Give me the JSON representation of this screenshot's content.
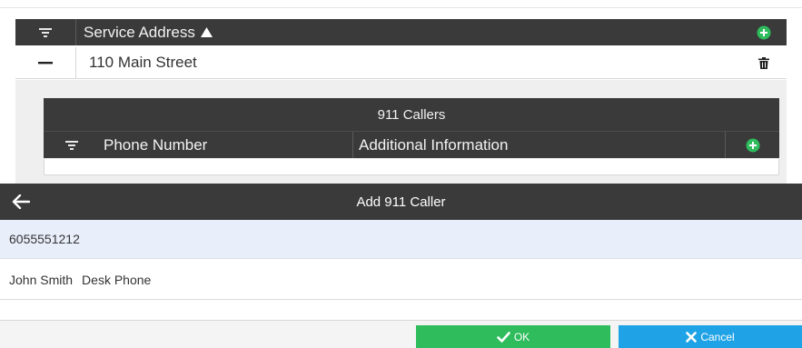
{
  "outer_grid": {
    "column_title": "Service Address",
    "row": {
      "address": "110 Main Street"
    }
  },
  "inner_grid": {
    "title": "911 Callers",
    "columns": [
      "Phone Number",
      "Additional Information"
    ]
  },
  "dialog": {
    "title": "Add 911 Caller",
    "phone": "6055551212",
    "name": "John Smith",
    "location": "Desk Phone"
  },
  "buttons": {
    "ok": "OK",
    "cancel": "Cancel"
  },
  "colors": {
    "header": "#3a3a3a",
    "add_green": "#2ebc5c",
    "ok_green": "#2ebc5c",
    "cancel_blue": "#1fa3e6",
    "selected_row": "#e9eefb"
  },
  "icons": {
    "filter": "filter-icon",
    "sort": "sort-ascending-icon",
    "add": "plus-circle-icon",
    "collapse": "minus-icon",
    "delete": "trash-icon",
    "back": "arrow-left-icon",
    "check": "check-icon",
    "close": "x-icon"
  }
}
